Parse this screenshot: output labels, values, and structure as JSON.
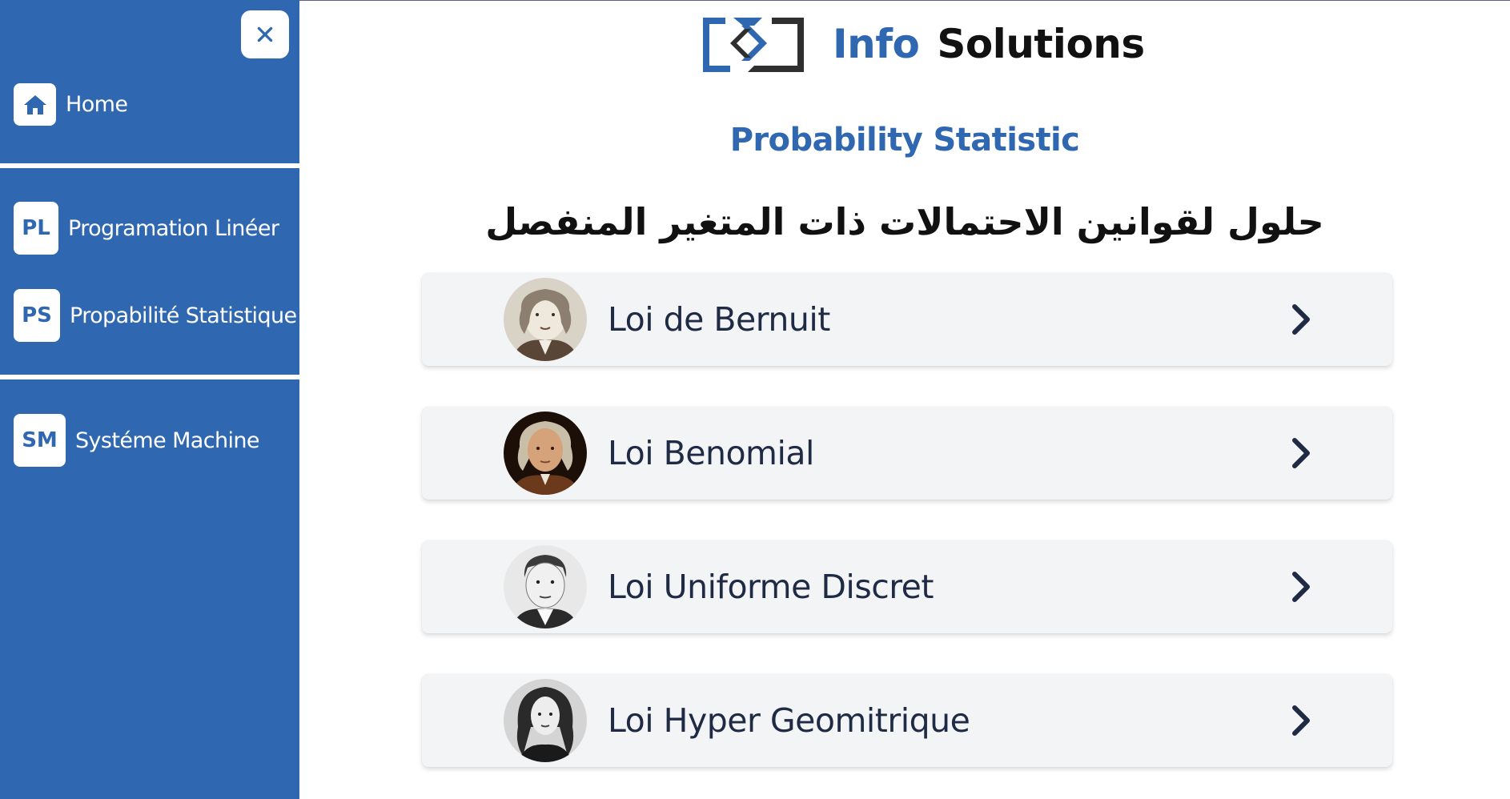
{
  "brand": {
    "name_part1": "Info",
    "name_part2": "Solutions",
    "accent": "#2f67b1"
  },
  "sidebar": {
    "close_icon": "close-icon",
    "items": [
      {
        "badge": "",
        "icon": "home-icon",
        "label": "Home"
      },
      {
        "badge": "PL",
        "label": "Programation Linéer"
      },
      {
        "badge": "PS",
        "label": "Propabilité Statistique"
      },
      {
        "badge": "SM",
        "label": "Systéme Machine"
      }
    ]
  },
  "main": {
    "section_title": "Probability Statistic",
    "arabic_title": "حلول لقوانين الاحتمالات ذات المتغير المنفصل",
    "laws": [
      {
        "label": "Loi de Bernuit",
        "avatar": "portrait-avatar",
        "icon": "chevron-right-icon"
      },
      {
        "label": "Loi Benomial",
        "avatar": "portrait-avatar",
        "icon": "chevron-right-icon"
      },
      {
        "label": "Loi Uniforme Discret",
        "avatar": "portrait-avatar",
        "icon": "chevron-right-icon"
      },
      {
        "label": "Loi Hyper Geomitrique",
        "avatar": "portrait-avatar",
        "icon": "chevron-right-icon"
      }
    ]
  }
}
